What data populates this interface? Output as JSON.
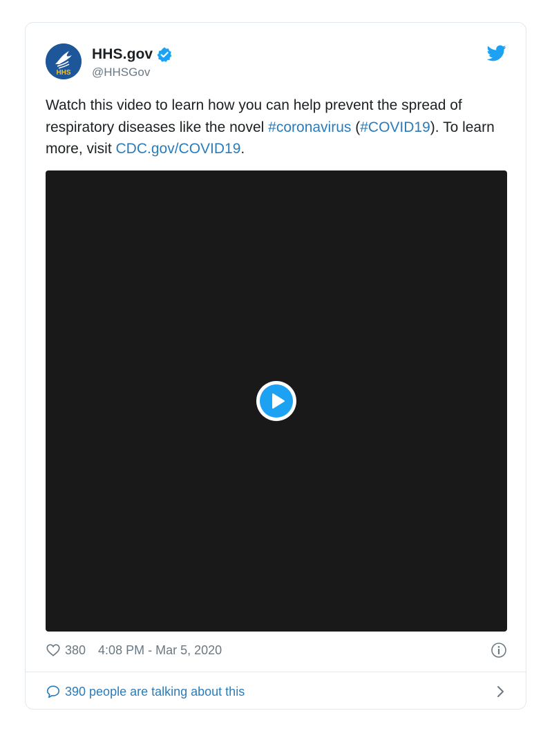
{
  "author": {
    "display_name": "HHS.gov",
    "handle": "@HHSGov",
    "avatar_icon": "hhs-logo-icon",
    "avatar_text": "HHS",
    "verified_icon": "verified-badge-icon"
  },
  "brand": {
    "icon": "twitter-bird-icon",
    "accent_color": "#1da1f2",
    "link_color": "#2b7bb9"
  },
  "tweet": {
    "text_part1": "Watch this video to learn how you can help prevent the spread of respiratory diseases like the novel ",
    "hashtag1": "#coronavirus",
    "text_part2": " (",
    "hashtag2": "#COVID19",
    "text_part3": "). To learn more, visit ",
    "link": "CDC.gov/COVID19",
    "text_part4": "."
  },
  "media": {
    "type": "video",
    "play_icon": "play-icon"
  },
  "meta": {
    "heart_icon": "heart-icon",
    "like_count": "380",
    "timestamp": "4:08 PM - Mar 5, 2020",
    "info_icon": "info-icon"
  },
  "footer": {
    "bubble_icon": "speech-bubble-icon",
    "talking_text": "390 people are talking about this",
    "chevron_icon": "chevron-right-icon"
  }
}
